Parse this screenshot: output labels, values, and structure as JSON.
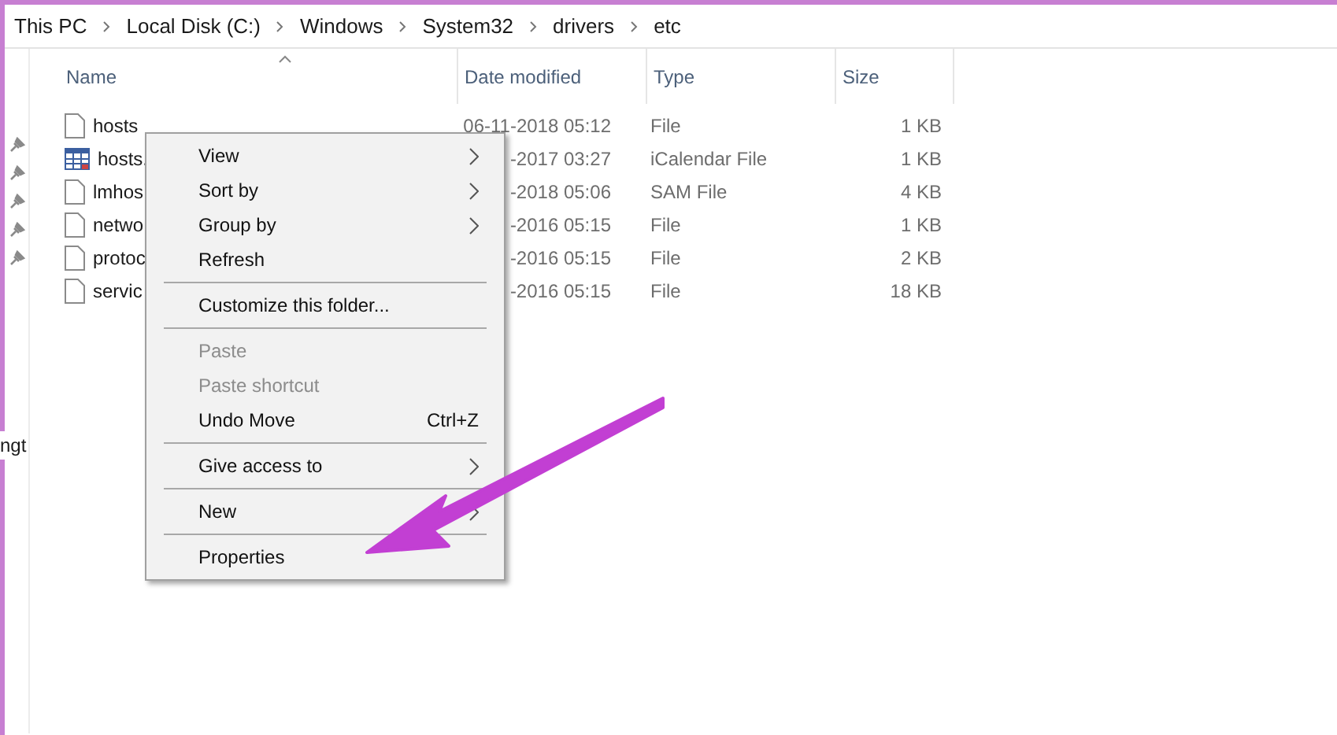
{
  "breadcrumb": [
    "This PC",
    "Local Disk (C:)",
    "Windows",
    "System32",
    "drivers",
    "etc"
  ],
  "nav_pane": {
    "pinned_count_label": "ngt"
  },
  "columns": [
    "Name",
    "Date modified",
    "Type",
    "Size"
  ],
  "files": [
    {
      "name": "hosts",
      "date": "06-11-2018 05:12",
      "type": "File",
      "size": "1 KB",
      "kind": "file"
    },
    {
      "name": "hosts.",
      "date": "-2017 03:27",
      "type": "iCalendar File",
      "size": "1 KB",
      "kind": "calendar"
    },
    {
      "name": "lmhos",
      "date": "-2018 05:06",
      "type": "SAM File",
      "size": "4 KB",
      "kind": "file"
    },
    {
      "name": "netwo",
      "date": "-2016 05:15",
      "type": "File",
      "size": "1 KB",
      "kind": "file"
    },
    {
      "name": "protoc",
      "date": "-2016 05:15",
      "type": "File",
      "size": "2 KB",
      "kind": "file"
    },
    {
      "name": "servic",
      "date": "-2016 05:15",
      "type": "File",
      "size": "18 KB",
      "kind": "file"
    }
  ],
  "context_menu": [
    {
      "kind": "item",
      "label": "View",
      "submenu": true,
      "disabled": false
    },
    {
      "kind": "item",
      "label": "Sort by",
      "submenu": true,
      "disabled": false
    },
    {
      "kind": "item",
      "label": "Group by",
      "submenu": true,
      "disabled": false
    },
    {
      "kind": "item",
      "label": "Refresh",
      "submenu": false,
      "disabled": false
    },
    {
      "kind": "separator"
    },
    {
      "kind": "item",
      "label": "Customize this folder...",
      "submenu": false,
      "disabled": false
    },
    {
      "kind": "separator"
    },
    {
      "kind": "item",
      "label": "Paste",
      "submenu": false,
      "disabled": true
    },
    {
      "kind": "item",
      "label": "Paste shortcut",
      "submenu": false,
      "disabled": true
    },
    {
      "kind": "item",
      "label": "Undo Move",
      "shortcut": "Ctrl+Z",
      "submenu": false,
      "disabled": false
    },
    {
      "kind": "separator"
    },
    {
      "kind": "item",
      "label": "Give access to",
      "submenu": true,
      "disabled": false
    },
    {
      "kind": "separator"
    },
    {
      "kind": "item",
      "label": "New",
      "submenu": true,
      "disabled": false
    },
    {
      "kind": "separator"
    },
    {
      "kind": "item",
      "label": "Properties",
      "submenu": false,
      "disabled": false
    }
  ]
}
